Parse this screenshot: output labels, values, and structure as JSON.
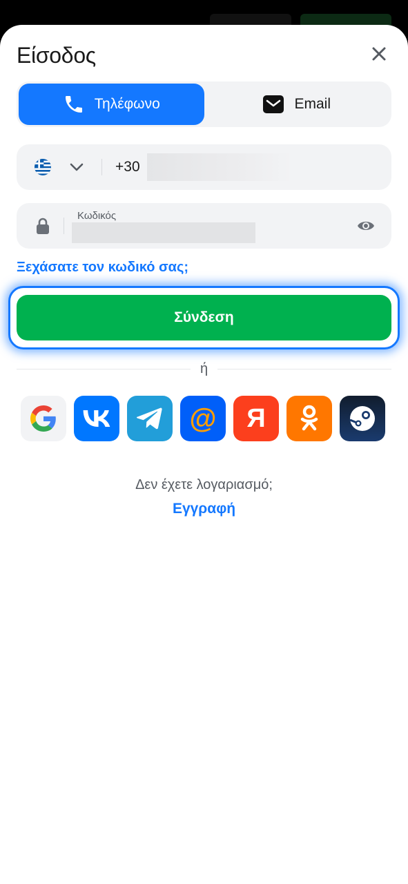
{
  "header": {
    "title": "Είσοδος"
  },
  "tabs": [
    {
      "label": "Τηλέφωνο",
      "icon": "phone-icon",
      "active": true
    },
    {
      "label": "Email",
      "icon": "mail-icon",
      "active": false
    }
  ],
  "phone": {
    "country_icon": "greece-flag-icon",
    "prefix": "+30",
    "value": ""
  },
  "password": {
    "label": "Κωδικός",
    "value": ""
  },
  "forgot_link": "Ξεχάσατε τον κωδικό σας;",
  "login_button": "Σύνδεση",
  "divider_text": "ή",
  "social": [
    {
      "name": "google",
      "label": "G"
    },
    {
      "name": "vk",
      "label": "VK"
    },
    {
      "name": "telegram",
      "label": ""
    },
    {
      "name": "mailru",
      "label": "@"
    },
    {
      "name": "yandex",
      "label": "Я"
    },
    {
      "name": "odnoklassniki",
      "label": ""
    },
    {
      "name": "steam",
      "label": ""
    }
  ],
  "footer": {
    "no_account": "Δεν έχετε λογαριασμό;",
    "register": "Εγγραφή"
  },
  "colors": {
    "accent": "#1478ff",
    "primary_green": "#00b14f",
    "field_bg": "#f2f3f5"
  }
}
